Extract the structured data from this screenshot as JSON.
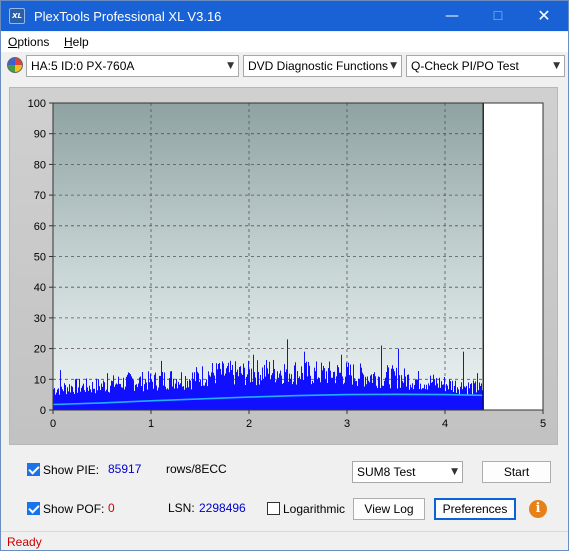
{
  "app": {
    "title": "PlexTools Professional XL V3.16",
    "icon_text": "XL",
    "minimize_glyph": "—",
    "maximize_glyph": "☐",
    "close_glyph": "✕"
  },
  "menu": {
    "options_label": "Options",
    "options_mnemonic": "O",
    "options_rest": "ptions",
    "help_label": "Help",
    "help_mnemonic": "H",
    "help_rest": "elp"
  },
  "toolbar": {
    "drive_icon": "disc-drive-icon",
    "drive_value": "HA:5 ID:0  PX-760A",
    "function_value": "DVD Diagnostic Functions",
    "test_value": "Q-Check PI/PO Test",
    "dropdown_arrow": "▼"
  },
  "chart_data": {
    "type": "bar",
    "title": "",
    "xlabel": "",
    "ylabel": "",
    "x_ticks": [
      "0",
      "1",
      "2",
      "3",
      "4",
      "5"
    ],
    "y_ticks": [
      "0",
      "10",
      "20",
      "30",
      "40",
      "50",
      "60",
      "70",
      "80",
      "90",
      "100"
    ],
    "xlim": [
      0,
      5
    ],
    "ylim": [
      0,
      100
    ],
    "grid": true,
    "end_marker_x": 4.39,
    "series": [
      {
        "kind": "bars",
        "color": "#1010ff",
        "description_points": [
          [
            0.0,
            8
          ],
          [
            0.2,
            9
          ],
          [
            0.4,
            9
          ],
          [
            0.6,
            10
          ],
          [
            0.8,
            11
          ],
          [
            1.0,
            11
          ],
          [
            1.2,
            12
          ],
          [
            1.4,
            12
          ],
          [
            1.6,
            14
          ],
          [
            1.8,
            14
          ],
          [
            2.0,
            14
          ],
          [
            2.2,
            15
          ],
          [
            2.4,
            15
          ],
          [
            2.6,
            14
          ],
          [
            2.8,
            14
          ],
          [
            3.0,
            14
          ],
          [
            3.2,
            13
          ],
          [
            3.4,
            13
          ],
          [
            3.6,
            12
          ],
          [
            3.8,
            11
          ],
          [
            4.0,
            10
          ],
          [
            4.2,
            9
          ],
          [
            4.38,
            8
          ]
        ],
        "peaks": [
          [
            0.07,
            13
          ],
          [
            0.55,
            12
          ],
          [
            1.1,
            16
          ],
          [
            1.68,
            15
          ],
          [
            2.04,
            18
          ],
          [
            2.39,
            23
          ],
          [
            2.56,
            19
          ],
          [
            2.94,
            18
          ],
          [
            3.35,
            21
          ],
          [
            3.52,
            20
          ],
          [
            4.18,
            19
          ],
          [
            4.33,
            12
          ]
        ]
      },
      {
        "kind": "line",
        "color": "#20b0ff",
        "x": [
          0.0,
          0.5,
          1.0,
          1.5,
          2.0,
          2.5,
          3.0,
          3.5,
          4.0,
          4.38
        ],
        "y": [
          1.8,
          2.3,
          3.0,
          3.6,
          4.2,
          4.7,
          5.0,
          5.1,
          5.0,
          4.8
        ]
      }
    ]
  },
  "bottom": {
    "show_pie_label": "Show PIE:",
    "show_pie_value": "85917",
    "rows_label": "rows/8ECC",
    "show_pof_label": "Show POF:",
    "show_pof_value": "0",
    "lsn_label": "LSN:",
    "lsn_value": "2298496",
    "logarithmic_label": "Logarithmic",
    "test_select_value": "SUM8 Test",
    "start_label": "Start",
    "view_log_label": "View Log",
    "preferences_label": "Preferences",
    "info_glyph": "i"
  },
  "status": {
    "text": "Ready"
  }
}
